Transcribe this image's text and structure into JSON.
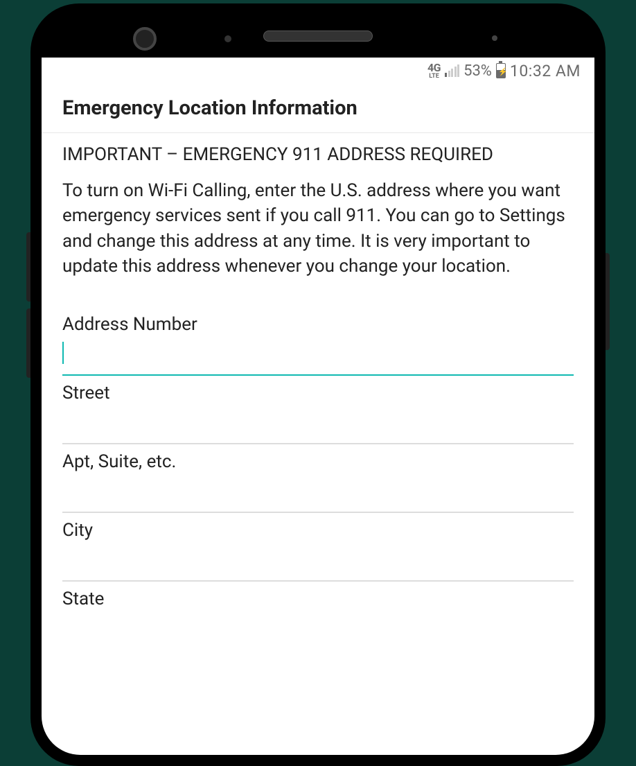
{
  "status_bar": {
    "network_label": "4G LTE",
    "battery_percent": "53%",
    "time": "10:32 AM"
  },
  "header": {
    "title": "Emergency Location Information"
  },
  "notice": {
    "heading": "IMPORTANT – EMERGENCY 911 ADDRESS REQUIRED",
    "body": "To turn on Wi-Fi Calling, enter the U.S. address where you want emergency services sent if you call 911. You can go to Settings and change this address at any time. It is very important to update this address whenever you change your location."
  },
  "fields": {
    "address_number": {
      "label": "Address Number",
      "value": ""
    },
    "street": {
      "label": "Street",
      "value": ""
    },
    "apt": {
      "label": "Apt, Suite, etc.",
      "value": ""
    },
    "city": {
      "label": "City",
      "value": ""
    },
    "state": {
      "label": "State",
      "value": ""
    }
  },
  "colors": {
    "accent": "#0fb9b1"
  }
}
